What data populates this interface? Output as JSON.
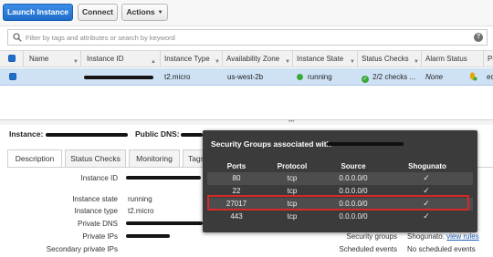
{
  "toolbar": {
    "launch_label": "Launch Instance",
    "connect_label": "Connect",
    "actions_label": "Actions"
  },
  "filter": {
    "placeholder": "Filter by tags and attributes or search by keyword",
    "help_label": "?"
  },
  "table": {
    "headers": [
      "Name",
      "Instance ID",
      "Instance Type",
      "Availability Zone",
      "Instance State",
      "Status Checks",
      "Alarm Status",
      "Pu"
    ],
    "row": {
      "instance_type": "t2.micro",
      "availability_zone": "us-west-2b",
      "instance_state": "running",
      "status_checks": "2/2 checks ...",
      "alarm_status": "None",
      "public_dns_cut": "ec"
    }
  },
  "details": {
    "instance_label": "Instance:",
    "public_dns_label": "Public DNS:",
    "tabs": [
      "Description",
      "Status Checks",
      "Monitoring",
      "Tags"
    ],
    "fields": {
      "instance_id_label": "Instance ID",
      "instance_state_label": "Instance state",
      "instance_state_value": "running",
      "instance_type_label": "Instance type",
      "instance_type_value": "t2.micro",
      "private_dns_label": "Private DNS",
      "private_ips_label": "Private IPs",
      "secondary_ips_label": "Secondary private IPs",
      "security_groups_label": "Security groups",
      "security_groups_value": "Shogunato",
      "view_rules_label": "view rules",
      "scheduled_events_label": "Scheduled events",
      "scheduled_events_value": "No scheduled events"
    }
  },
  "popup": {
    "title": "Security Groups associated with",
    "columns": [
      "Ports",
      "Protocol",
      "Source",
      "Shogunato"
    ],
    "rows": [
      {
        "port": "80",
        "protocol": "tcp",
        "source": "0.0.0.0/0",
        "allowed": "✓"
      },
      {
        "port": "22",
        "protocol": "tcp",
        "source": "0.0.0.0/0",
        "allowed": "✓"
      },
      {
        "port": "27017",
        "protocol": "tcp",
        "source": "0.0.0.0/0",
        "allowed": "✓"
      },
      {
        "port": "443",
        "protocol": "tcp",
        "source": "0.0.0.0/0",
        "allowed": "✓"
      }
    ]
  },
  "colors": {
    "primary_button": "#1f6dcb",
    "selected_row": "#cfe2f5",
    "running_status": "#3aa83a",
    "popup_background": "#3b3b3b",
    "highlight_border": "#d62a2a"
  }
}
